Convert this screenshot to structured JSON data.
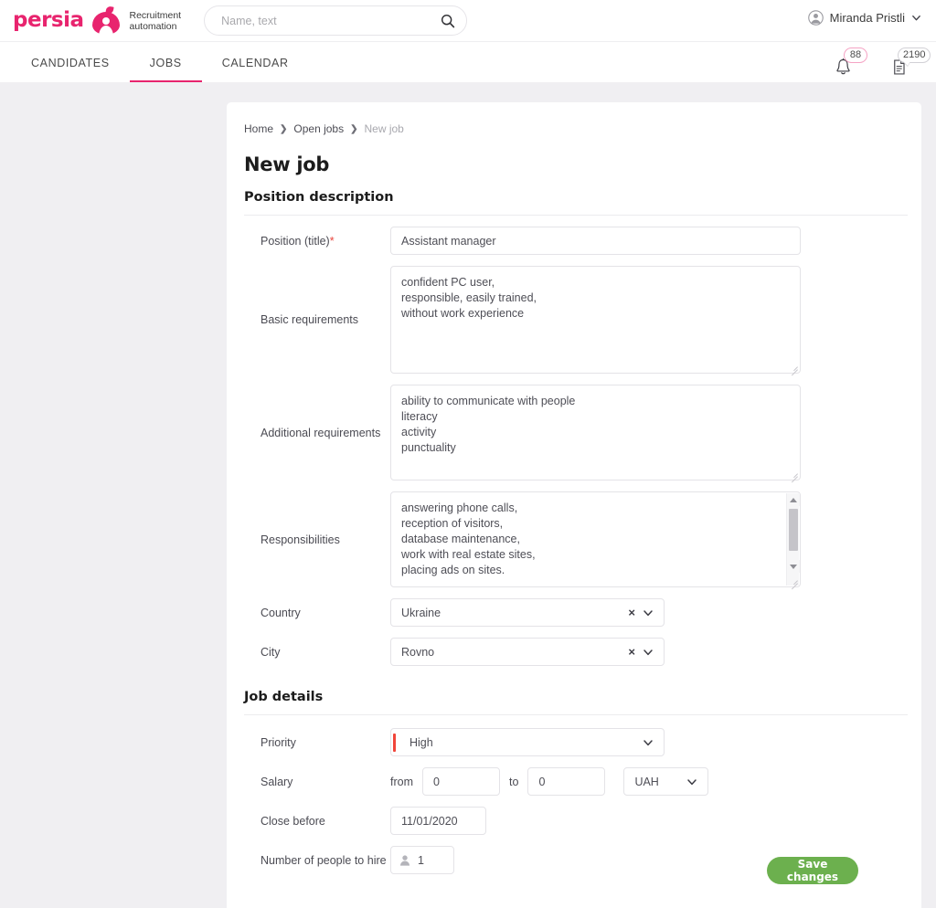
{
  "brand": {
    "wordmark": "persia",
    "tagline_line1": "Recruitment",
    "tagline_line2": "automation",
    "accent_pink": "#e8246e",
    "accent_green": "#6cb04e",
    "priority_red": "#f0453a"
  },
  "search": {
    "placeholder": "Name, text",
    "value": "",
    "icon": "search-icon"
  },
  "user": {
    "name": "Miranda Pristli",
    "avatar_icon": "user-circle-icon",
    "caret_icon": "chevron-down-icon"
  },
  "nav": {
    "tabs": [
      {
        "label": "CANDIDATES",
        "active": false
      },
      {
        "label": "JOBS",
        "active": true
      },
      {
        "label": "CALENDAR",
        "active": false
      }
    ]
  },
  "notifications": {
    "bell": {
      "icon": "bell-icon",
      "count": "88"
    },
    "documents": {
      "icon": "document-icon",
      "count": "2190"
    }
  },
  "breadcrumb": {
    "items": [
      "Home",
      "Open jobs",
      "New job"
    ],
    "separator": "❯"
  },
  "page": {
    "title": "New job"
  },
  "sections": {
    "position_description": {
      "title": "Position description",
      "fields": {
        "position_title": {
          "label": "Position (title)",
          "required_mark": "*",
          "value": "Assistant manager",
          "placeholder": ""
        },
        "basic_requirements": {
          "label": "Basic requirements",
          "value": "confident PC user,\nresponsible, easily trained,\nwithout work experience",
          "placeholder": ""
        },
        "additional_requirements": {
          "label": "Additional requirements",
          "value": "ability to communicate with people\nliteracy\nactivity\npunctuality",
          "placeholder": ""
        },
        "responsibilities": {
          "label": "Responsibilities",
          "value": "answering phone calls,\nreception of visitors,\ndatabase maintenance,\nwork with real estate sites,\nplacing ads on sites.",
          "placeholder": "",
          "has_scrollbar": true
        },
        "country": {
          "label": "Country",
          "value": "Ukraine",
          "clear_icon": "close-icon",
          "caret_icon": "chevron-down-icon"
        },
        "city": {
          "label": "City",
          "value": "Rovno",
          "clear_icon": "close-icon",
          "caret_icon": "chevron-down-icon"
        }
      }
    },
    "job_details": {
      "title": "Job details",
      "fields": {
        "priority": {
          "label": "Priority",
          "value": "High",
          "caret_icon": "chevron-down-icon"
        },
        "salary": {
          "label": "Salary",
          "from_word": "from",
          "from_value": "0",
          "to_word": "to",
          "to_value": "0",
          "currency": "UAH",
          "caret_icon": "chevron-down-icon"
        },
        "close_before": {
          "label": "Close before",
          "value": "11/01/2020"
        },
        "people_to_hire": {
          "label": "Number of people to hire",
          "value": "1",
          "icon": "person-icon"
        }
      }
    }
  },
  "footer": {
    "save_label": "Save changes"
  }
}
